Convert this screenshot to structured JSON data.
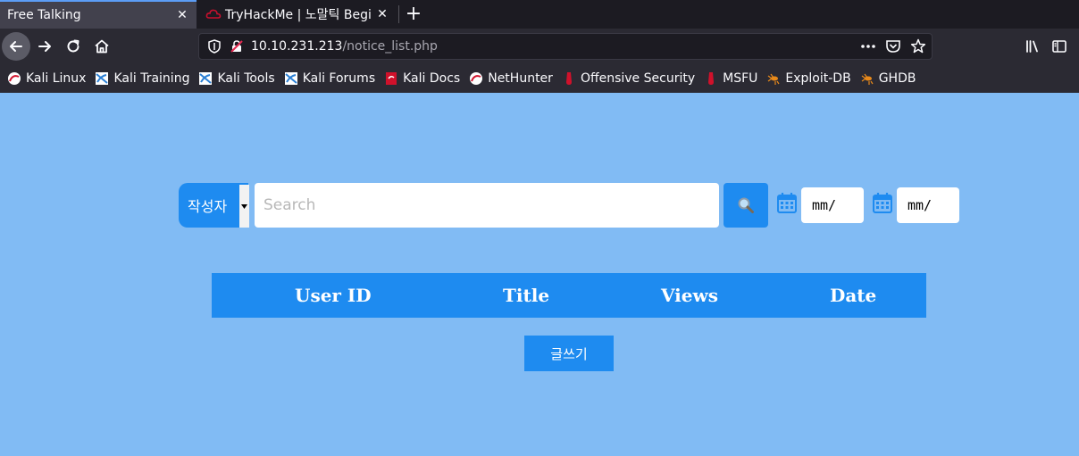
{
  "browser": {
    "tabs": [
      {
        "title": "Free Talking",
        "active": true
      },
      {
        "title": "TryHackMe | 노말틱 Beginner",
        "active": false
      }
    ],
    "new_tab_label": "+",
    "url": {
      "host": "10.10.231.213",
      "path": "/notice_list.php"
    },
    "bookmarks": [
      {
        "label": "Kali Linux",
        "icon": "kali-icon"
      },
      {
        "label": "Kali Training",
        "icon": "kali-training-icon"
      },
      {
        "label": "Kali Tools",
        "icon": "kali-tools-icon"
      },
      {
        "label": "Kali Forums",
        "icon": "kali-forums-icon"
      },
      {
        "label": "Kali Docs",
        "icon": "kali-docs-icon"
      },
      {
        "label": "NetHunter",
        "icon": "nethunter-icon"
      },
      {
        "label": "Offensive Security",
        "icon": "offsec-icon"
      },
      {
        "label": "MSFU",
        "icon": "msfu-icon"
      },
      {
        "label": "Exploit-DB",
        "icon": "exploitdb-icon"
      },
      {
        "label": "GHDB",
        "icon": "ghdb-icon"
      }
    ]
  },
  "search": {
    "filter_selected": "작성자",
    "placeholder": "Search",
    "value": "",
    "date_from": "mm/",
    "date_to": "mm/"
  },
  "table": {
    "headers": [
      "User ID",
      "Title",
      "Views",
      "Date"
    ]
  },
  "write_button": "글쓰기",
  "colors": {
    "page_bg": "#81bbf4",
    "accent": "#1e8bf0"
  }
}
